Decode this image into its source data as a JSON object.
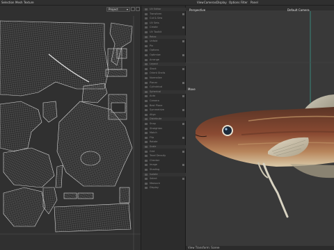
{
  "menubar": {
    "uv_items": [
      "Selection",
      "Mesh",
      "Texture"
    ],
    "viewport_items": [
      "View",
      "Cameras",
      "Display",
      "Options",
      "Filter",
      "Panel"
    ]
  },
  "uv_editor": {
    "dropdown_value": "Project"
  },
  "tools": {
    "rows": [
      "UV Editor",
      "Transform",
      "Cut & Sew",
      "UV Sets",
      "Create",
      "UV Toolkit",
      "Relax",
      "Unfold",
      "Pin",
      "Options",
      "Optimize",
      "Arrange",
      "Layout",
      "Stack",
      "Orient Shells",
      "Normalize",
      "Planar",
      "Cylindrical",
      "Spherical",
      "Auto",
      "Camera",
      "Best Plane",
      "Symmetrize",
      "Align",
      "Distribute",
      "Snap",
      "Straighten",
      "Match",
      "Flip",
      "Rotate",
      "Scale",
      "Grid",
      "Texel Density",
      "Checker",
      "Image",
      "Shading",
      "Isolate",
      "Select",
      "Measure",
      "Display"
    ]
  },
  "viewport": {
    "camera_label": "Perspective",
    "default_camera_label": "Default Camera",
    "move_label": "Move",
    "footer_label": "View Transform: Scene"
  },
  "colors": {
    "uv_background": "#303030",
    "wireframe": "#9a9a9a",
    "viewport_background": "#393939",
    "fish_body": "#8a4a32",
    "accent_teal": "#3aa89a"
  }
}
